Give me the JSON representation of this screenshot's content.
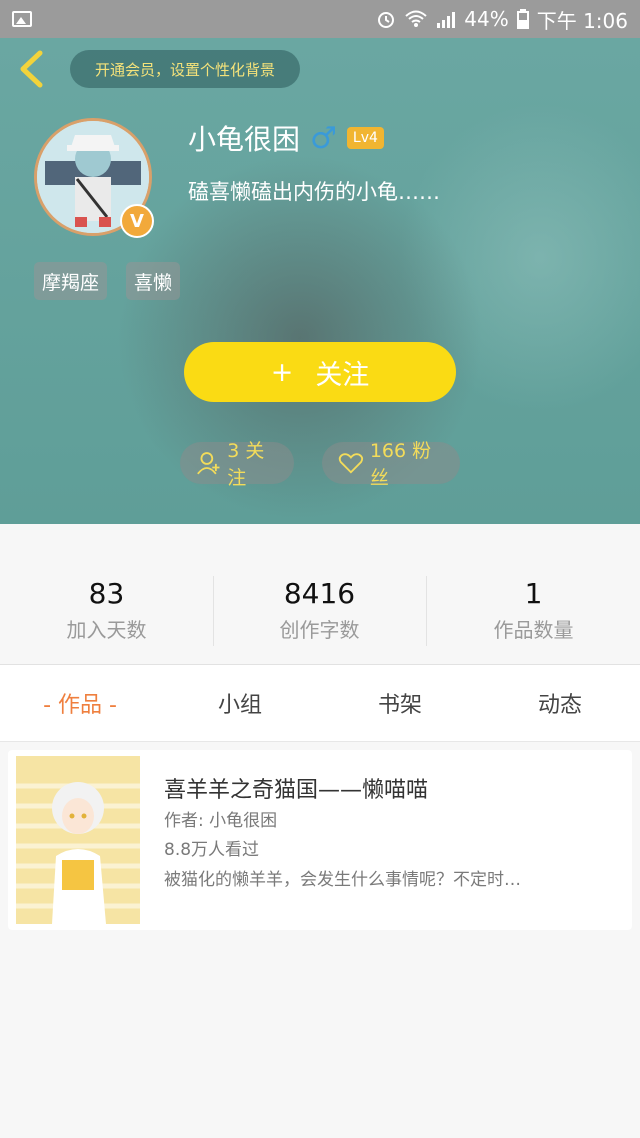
{
  "status_bar": {
    "battery": "44%",
    "time": "下午 1:06"
  },
  "header": {
    "vip_banner": "开通会员，设置个性化背景",
    "username": "小龟很困",
    "gender_symbol": "♂",
    "level": "Lv4",
    "bio": "磕喜懒磕出内伤的小龟……",
    "avatar_badge": "V",
    "tags": [
      "摩羯座",
      "喜懒"
    ],
    "follow_button": {
      "plus": "+",
      "label": "关注"
    },
    "following_pill": "3 关注",
    "fans_pill": "166 粉丝"
  },
  "stats": [
    {
      "value": "83",
      "label": "加入天数"
    },
    {
      "value": "8416",
      "label": "创作字数"
    },
    {
      "value": "1",
      "label": "作品数量"
    }
  ],
  "tabs": [
    {
      "label": "- 作品 -",
      "active": true
    },
    {
      "label": "小组",
      "active": false
    },
    {
      "label": "书架",
      "active": false
    },
    {
      "label": "动态",
      "active": false
    }
  ],
  "works": [
    {
      "title": "喜羊羊之奇猫国——懒喵喵",
      "author": "作者: 小龟很困",
      "views": "8.8万人看过",
      "description": "被猫化的懒羊羊，会发生什么事情呢？不定时…"
    }
  ],
  "colors": {
    "accent_yellow": "#fadb14",
    "tab_active": "#ef7f3e",
    "header_teal": "#6aa7a2"
  }
}
